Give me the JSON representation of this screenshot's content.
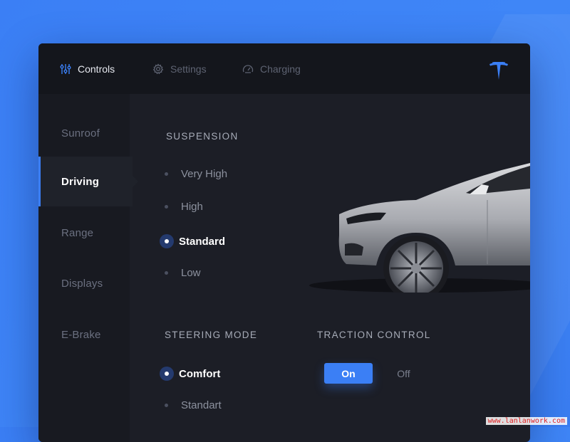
{
  "colors": {
    "accent": "#3b7ff5",
    "background": "#3f86f7",
    "window": "#1c1e26",
    "topbar": "#14161c"
  },
  "topbar": {
    "tabs": [
      {
        "label": "Controls",
        "icon": "sliders-icon",
        "active": true
      },
      {
        "label": "Settings",
        "icon": "gear-icon",
        "active": false
      },
      {
        "label": "Charging",
        "icon": "charging-gauge-icon",
        "active": false
      }
    ],
    "logo": "tesla-logo-icon"
  },
  "sidebar": {
    "items": [
      {
        "label": "Sunroof",
        "active": false
      },
      {
        "label": "Driving",
        "active": true
      },
      {
        "label": "Range",
        "active": false
      },
      {
        "label": "Displays",
        "active": false
      },
      {
        "label": "E-Brake",
        "active": false
      }
    ]
  },
  "suspension": {
    "title": "SUSPENSION",
    "options": [
      {
        "label": "Very High",
        "selected": false
      },
      {
        "label": "High",
        "selected": false
      },
      {
        "label": "Standard",
        "selected": true
      },
      {
        "label": "Low",
        "selected": false
      }
    ]
  },
  "steering": {
    "title": "STEERING MODE",
    "options": [
      {
        "label": "Comfort",
        "selected": true
      },
      {
        "label": "Standart",
        "selected": false
      }
    ]
  },
  "traction": {
    "title": "TRACTION CONTROL",
    "on_label": "On",
    "off_label": "Off",
    "value": "On"
  },
  "watermark": "www.lanlanwork.com"
}
